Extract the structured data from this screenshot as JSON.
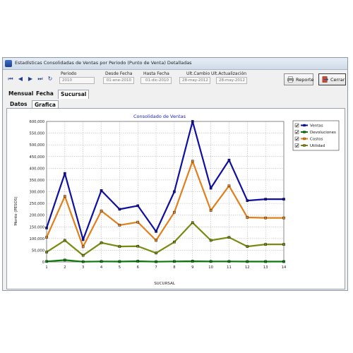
{
  "window": {
    "title": "Estadísticas Consolidadas de Ventas por Periodo (Punto de Venta) Detalladas"
  },
  "nav": {
    "first_icon": "first-record-icon",
    "prev_icon": "prev-record-icon",
    "next_icon": "next-record-icon",
    "last_icon": "last-record-icon",
    "refresh_icon": "refresh-icon"
  },
  "fields": {
    "periodo": {
      "label": "Periodo",
      "value": "2010"
    },
    "desde": {
      "label": "Desde Fecha",
      "value": "01-ene-2010"
    },
    "hasta": {
      "label": "Hasta Fecha",
      "value": "01-dic-2010"
    },
    "ult_cambio": {
      "label": "Ult.Cambio",
      "value": "28-may-2012"
    },
    "ult_actualizacion": {
      "label": "Ult.Actualización",
      "value": "28-may-2012"
    }
  },
  "buttons": {
    "reporte": "Reporte",
    "cerrar": "Cerrar"
  },
  "tabs": {
    "mensual": "Mensual",
    "fecha": "Fecha",
    "sucursal": "Sucursal"
  },
  "subtabs": {
    "datos": "Datos",
    "grafica": "Grafica"
  },
  "colors": {
    "ventas": "#1010a0",
    "devoluciones": "#0a7a0a",
    "costos": "#e0801c",
    "utilidad": "#7a8a10"
  },
  "chart_data": {
    "type": "line",
    "title": "Consolidado de Ventas",
    "xlabel": "SUCURSAL",
    "ylabel": "Monto (PESOS)",
    "x": [
      1,
      2,
      3,
      4,
      5,
      6,
      7,
      8,
      9,
      10,
      11,
      12,
      13,
      14
    ],
    "ylim": [
      0,
      600000
    ],
    "yticks": [
      "0",
      "50,000",
      "100,000",
      "150,000",
      "200,000",
      "250,000",
      "300,000",
      "350,000",
      "400,000",
      "450,000",
      "500,000",
      "550,000",
      "600,000"
    ],
    "grid": true,
    "legend_position": "top-right",
    "series": [
      {
        "name": "Ventas",
        "color": "#1010a0",
        "values": [
          145000,
          378000,
          95000,
          305000,
          225000,
          240000,
          130000,
          300000,
          600000,
          315000,
          435000,
          262000,
          268000,
          268000
        ]
      },
      {
        "name": "Devoluciones",
        "color": "#0a7a0a",
        "values": [
          2000,
          8000,
          1000,
          2000,
          1500,
          3000,
          1000,
          2000,
          3000,
          2000,
          2000,
          1500,
          1500,
          1500
        ]
      },
      {
        "name": "Costos",
        "color": "#e0801c",
        "values": [
          105000,
          280000,
          65000,
          218000,
          157000,
          170000,
          92000,
          212000,
          430000,
          220000,
          325000,
          190000,
          188000,
          188000
        ]
      },
      {
        "name": "Utilidad",
        "color": "#7a8a10",
        "values": [
          42000,
          92000,
          28000,
          82000,
          66000,
          67000,
          38000,
          85000,
          168000,
          92000,
          105000,
          66000,
          75000,
          75000
        ]
      }
    ]
  }
}
